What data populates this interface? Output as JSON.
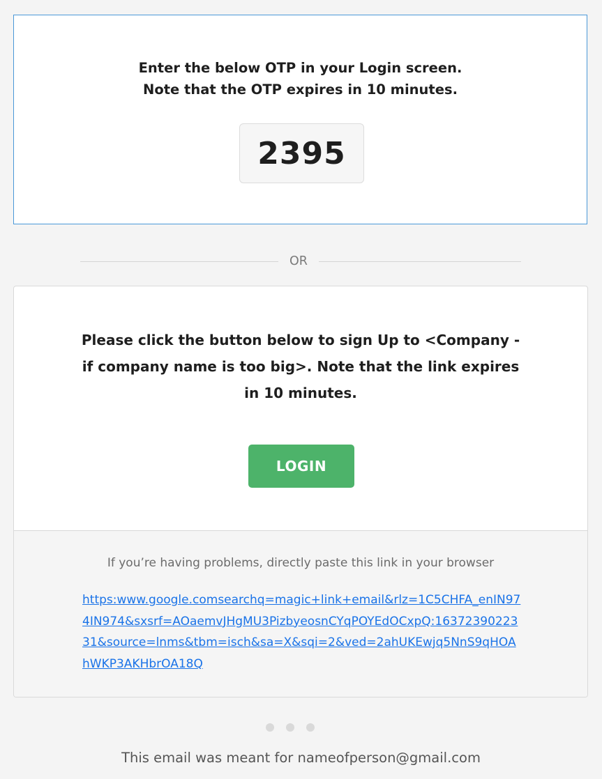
{
  "otp_section": {
    "instruction_line_1": "Enter the below OTP in your Login screen.",
    "instruction_line_2": "Note that the OTP expires in 10 minutes.",
    "otp_code": "2395"
  },
  "divider": {
    "label": "OR"
  },
  "login_section": {
    "message": "Please click the button below to sign Up to <Company - if company name is too big>. Note that the link expires in 10 minutes.",
    "button_label": "LOGIN"
  },
  "fallback_section": {
    "problem_text": "If you’re having problems, directly paste this link in your browser",
    "link": "https:www.google.comsearchq=magic+link+email&rlz=1C5CHFA_enIN974IN974&sxsrf=AOaemvJHgMU3PizbyeosnCYqPOYEdOCxpQ:1637239022331&source=lnms&tbm=isch&sa=X&sqi=2&ved=2ahUKEwjq5NnS9qHOAhWKP3AKHbrOA18Q"
  },
  "pagination": {
    "dot_count": 3
  },
  "footer": {
    "text": "This email was meant for nameofperson@gmail.com"
  },
  "colors": {
    "otp_card_border": "#4a98d8",
    "button_green": "#4db36a",
    "link_blue": "#1a73e8",
    "page_background": "#f4f4f4"
  }
}
